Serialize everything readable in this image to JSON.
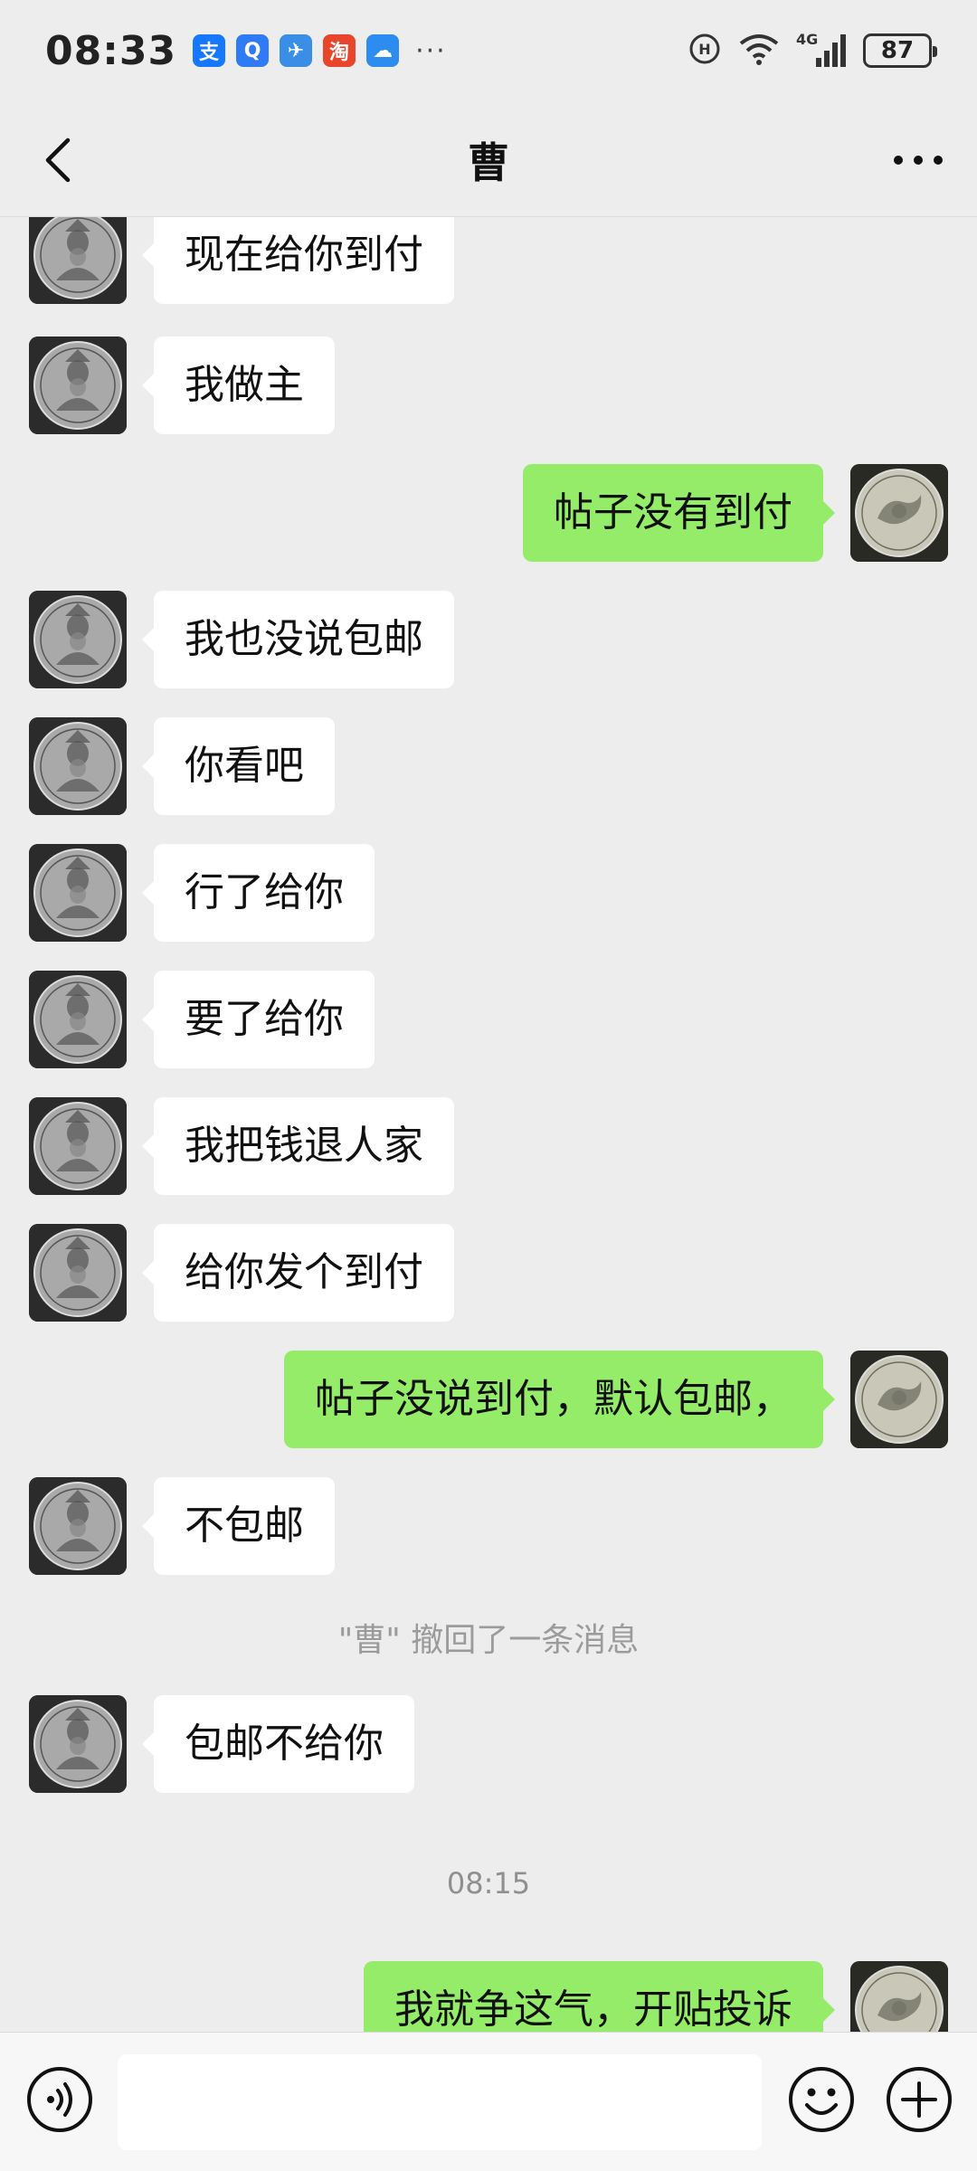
{
  "status_bar": {
    "time": "08:33",
    "apps": [
      {
        "name": "alipay-icon",
        "glyph": "支",
        "color": "#1677ff"
      },
      {
        "name": "search-app-icon",
        "glyph": "Q",
        "color": "#2f7bf5"
      },
      {
        "name": "flight-app-icon",
        "glyph": "✈",
        "color": "#3a8ee6"
      },
      {
        "name": "taobao-icon",
        "glyph": "淘",
        "color": "#e8452c"
      },
      {
        "name": "weather-app-icon",
        "glyph": "☁",
        "color": "#2d8cf0"
      }
    ],
    "more": "···",
    "network": "4G",
    "battery": "87"
  },
  "header": {
    "title": "曹"
  },
  "messages": [
    {
      "sender": "other",
      "text": "现在给你到付"
    },
    {
      "sender": "other",
      "text": "我做主"
    },
    {
      "sender": "me",
      "text": "帖子没有到付"
    },
    {
      "sender": "other",
      "text": "我也没说包邮"
    },
    {
      "sender": "other",
      "text": "你看吧"
    },
    {
      "sender": "other",
      "text": "行了给你"
    },
    {
      "sender": "other",
      "text": "要了给你"
    },
    {
      "sender": "other",
      "text": "我把钱退人家"
    },
    {
      "sender": "other",
      "text": "给你发个到付"
    },
    {
      "sender": "me",
      "text": "帖子没说到付，默认包邮，"
    },
    {
      "sender": "other",
      "text": "不包邮"
    },
    {
      "sender": "other",
      "text": "包邮不给你"
    },
    {
      "sender": "me",
      "text": "我就争这气，开贴投诉"
    }
  ],
  "system_note": "\"曹\" 撤回了一条消息",
  "timestamp": "08:15",
  "input": {
    "value": "",
    "placeholder": ""
  },
  "colors": {
    "background": "#ededed",
    "my_bubble": "#95ec69",
    "other_bubble": "#ffffff"
  }
}
